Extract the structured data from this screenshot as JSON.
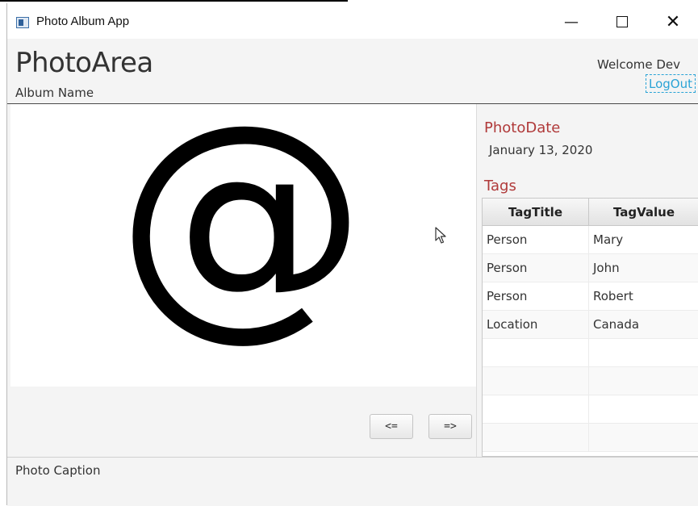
{
  "window": {
    "title": "Photo Album App",
    "minimize_glyph": "—",
    "close_glyph": "✕"
  },
  "header": {
    "title": "PhotoArea",
    "album_name": "Album Name",
    "welcome": "Welcome Dev",
    "logout": "LogOut"
  },
  "photo": {
    "glyph": "@"
  },
  "nav": {
    "prev": "<=",
    "next": "=>"
  },
  "details": {
    "photodate_label": "PhotoDate",
    "photodate_value": "January 13, 2020",
    "tags_label": "Tags"
  },
  "tags_table": {
    "columns": [
      "TagTitle",
      "TagValue"
    ],
    "rows": [
      [
        "Person",
        "Mary"
      ],
      [
        "Person",
        "John"
      ],
      [
        "Person",
        "Robert"
      ],
      [
        "Location",
        "Canada"
      ],
      [
        "",
        ""
      ],
      [
        "",
        ""
      ],
      [
        "",
        ""
      ],
      [
        "",
        ""
      ]
    ]
  },
  "caption": "Photo Caption",
  "colors": {
    "section_label": "#b03a3a",
    "link": "#2aa3d6",
    "pane_bg": "#f4f4f4"
  },
  "icons": {
    "app": "app-window-icon",
    "cursor": "mouse-pointer-icon"
  }
}
